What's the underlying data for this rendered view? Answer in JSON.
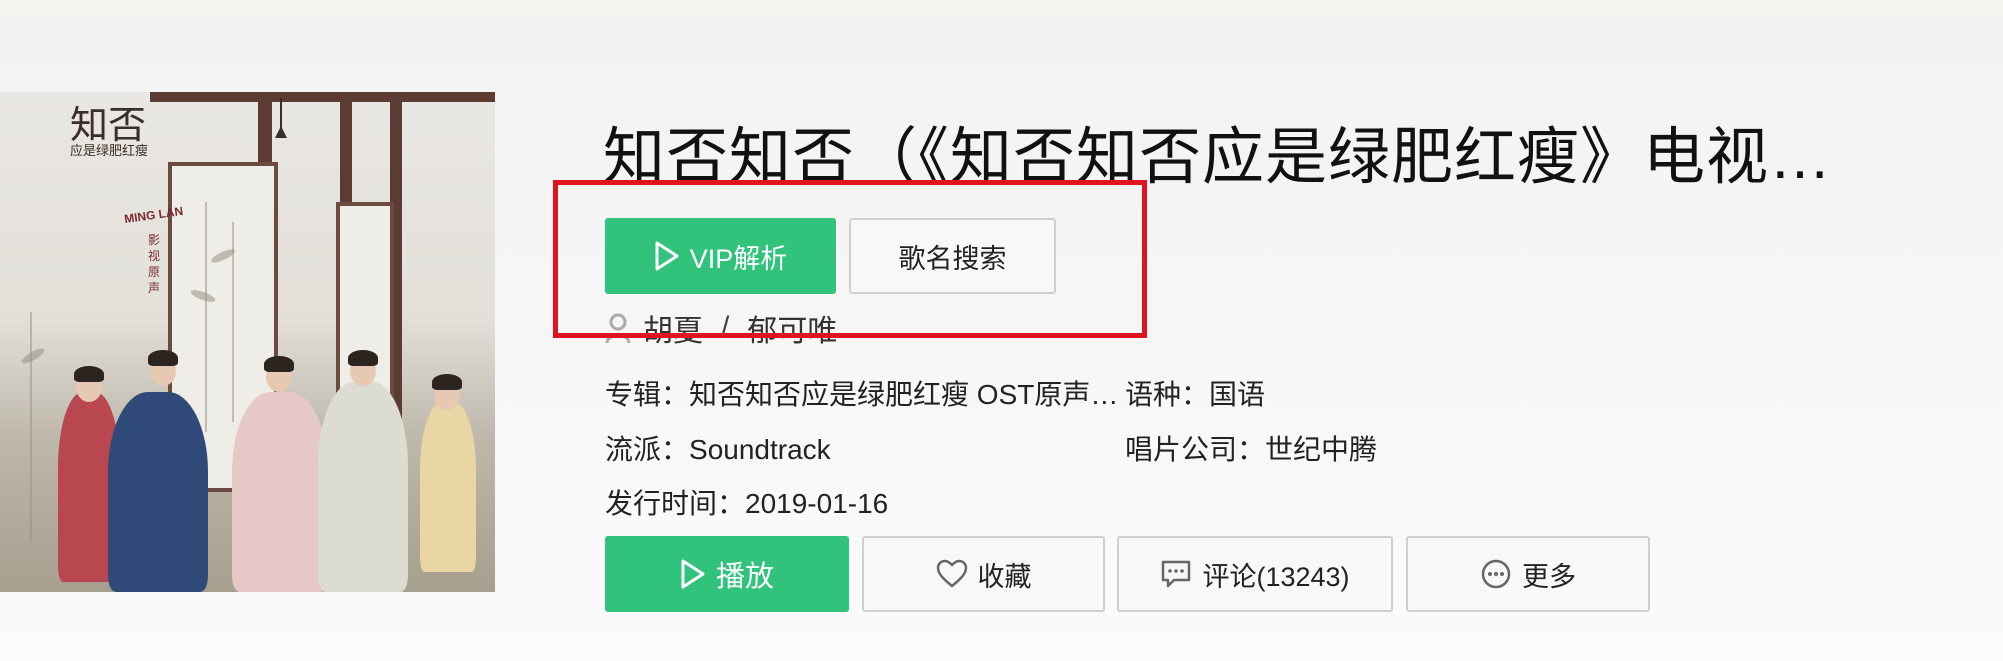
{
  "song": {
    "title": "知否知否（《知否知否应是绿肥红瘦》电视…",
    "singers": [
      "胡夏",
      "郁可唯"
    ],
    "separator": "/"
  },
  "cover": {
    "calligraphy_big": "知否",
    "calligraphy_small": "应是绿肥红瘦",
    "logo_text": "MING LAN",
    "stamp_text": "影视原声"
  },
  "top_actions": {
    "vip_label": "VIP解析",
    "search_label": "歌名搜索"
  },
  "info": {
    "album_label": "专辑：",
    "album_value": "知否知否应是绿肥红瘦 OST原声…",
    "language_label": "语种：",
    "language_value": "国语",
    "genre_label": "流派：",
    "genre_value": "Soundtrack",
    "company_label": "唱片公司：",
    "company_value": "世纪中腾",
    "release_label": "发行时间：",
    "release_value": "2019-01-16"
  },
  "actions": {
    "play_label": "播放",
    "favorite_label": "收藏",
    "comment_label": "评论(13243)",
    "more_label": "更多"
  },
  "colors": {
    "accent_green": "#31c27c",
    "highlight_red": "#e0141e"
  },
  "icons": [
    "play-icon",
    "person-icon",
    "heart-icon",
    "comment-icon",
    "more-icon"
  ]
}
